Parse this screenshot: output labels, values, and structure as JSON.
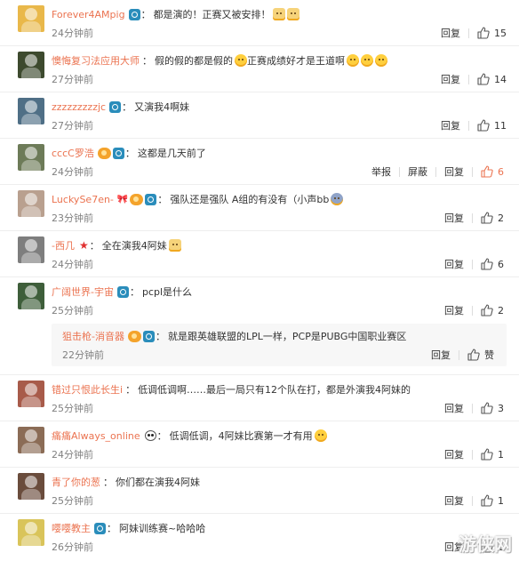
{
  "actions": {
    "reply": "回复",
    "report": "举报",
    "block": "屏蔽",
    "like": "赞"
  },
  "colors": {
    "username": "#eb7350",
    "time": "#808080",
    "text": "#333333",
    "liked": "#eb7350",
    "reply_bg": "#f7f7f7"
  },
  "comments": [
    {
      "username": "Forever4AMpig",
      "text": "都是演的！正赛又被安排！",
      "time": "24分钟前",
      "likes": "15",
      "avatar_color": "#e9b84a",
      "emojis": [
        "pig-face-emoji",
        "pig-face-emoji"
      ]
    },
    {
      "username": "懊悔复习法应用大师",
      "text": "假的假的都是假的",
      "text2": "正赛成绩好才是王道啊",
      "time": "27分钟前",
      "likes": "14",
      "avatar_color": "#3d4a2e"
    },
    {
      "username": "zzzzzzzzzjc",
      "text": "又演我4啊妹",
      "time": "27分钟前",
      "likes": "11",
      "avatar_color": "#4f6f86"
    },
    {
      "username": "cccC罗浩",
      "text": "这都是几天前了",
      "time": "24分钟前",
      "likes": "6",
      "avatar_color": "#6d7b58"
    },
    {
      "username": "LuckySe7en-",
      "text": "强队还是强队 A组的有没有（小声bb",
      "time": "23分钟前",
      "likes": "2",
      "avatar_color": "#b9a08f"
    },
    {
      "username": "-西几",
      "text": "全在演我4阿妹",
      "time": "24分钟前",
      "likes": "6",
      "avatar_color": "#7e7e7e"
    },
    {
      "username": "广阔世界-宇宙",
      "text": "pcpl是什么",
      "time": "25分钟前",
      "likes": "2",
      "avatar_color": "#3e5e3a"
    },
    {
      "username": "错过只恨此长生i",
      "text": "低调低调啊……最后一局只有12个队在打，都是外演我4阿妹的",
      "time": "25分钟前",
      "likes": "3",
      "avatar_color": "#a85b4a"
    },
    {
      "username": "痛痛Always_online",
      "text": "低调低调，4阿妹比赛第一才有用",
      "time": "24分钟前",
      "likes": "1",
      "avatar_color": "#8b6c56"
    },
    {
      "username": "青了你的葱",
      "text": "你们都在演我4阿妹",
      "time": "25分钟前",
      "likes": "1",
      "avatar_color": "#6a4c3c"
    },
    {
      "username": "嘤嘤教主",
      "text": "阿妹训练赛~哈哈哈",
      "time": "26分钟前",
      "likes": "1",
      "avatar_color": "#d9c45a"
    }
  ],
  "reply": {
    "username": "狙击枪-消音器",
    "text": "就是跟英雄联盟的LPL一样，PCP是PUBG中国职业赛区",
    "time": "22分钟前"
  },
  "watermark": "游侠网"
}
